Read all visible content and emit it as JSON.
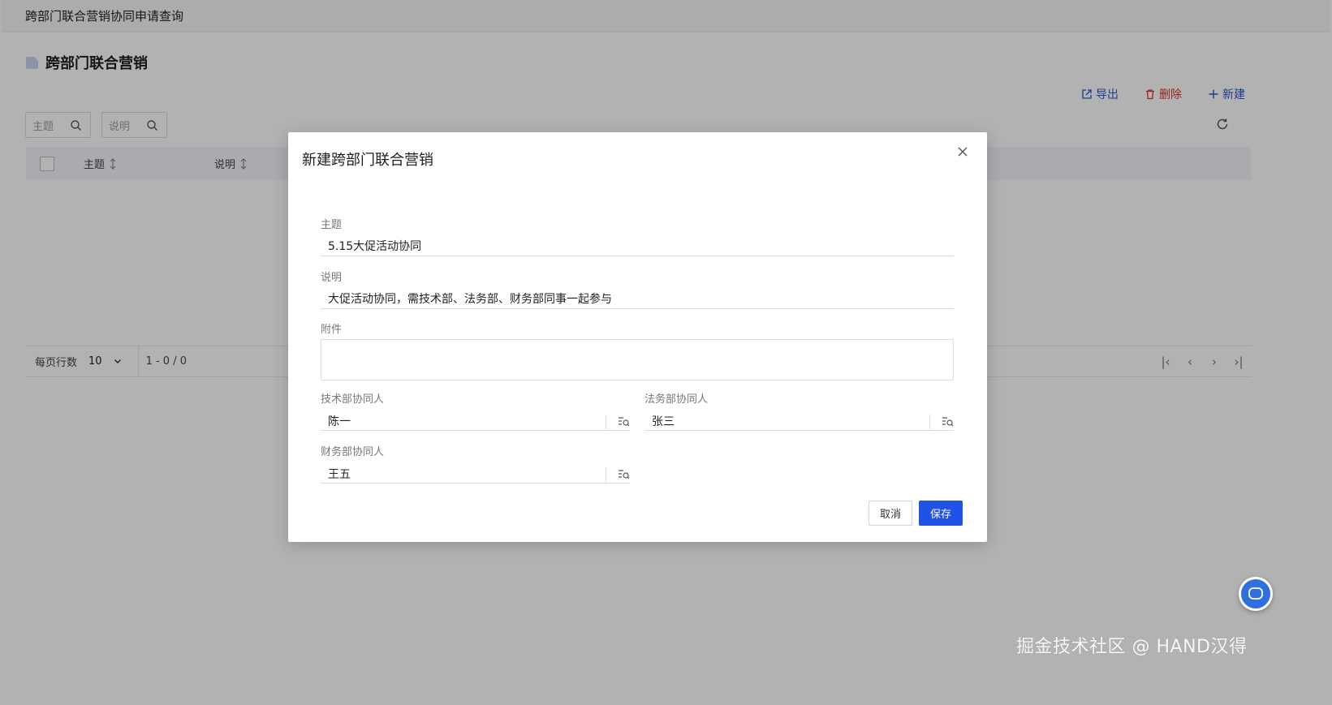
{
  "page": {
    "breadcrumb": "跨部门联合营销协同申请查询",
    "title": "跨部门联合营销",
    "actions": {
      "export": "导出",
      "delete": "删除",
      "create": "新建"
    },
    "search": [
      {
        "placeholder": "主题"
      },
      {
        "placeholder": "说明"
      }
    ],
    "table": {
      "columns": [
        "主题",
        "说明"
      ]
    },
    "pager": {
      "rows_label": "每页行数",
      "rows_value": "10",
      "range": "1 - 0 / 0"
    }
  },
  "modal": {
    "title": "新建跨部门联合营销",
    "fields": {
      "subject": {
        "label": "主题",
        "value": "5.15大促活动协同"
      },
      "description": {
        "label": "说明",
        "value": "大促活动协同，需技术部、法务部、财务部同事一起参与"
      },
      "attachment": {
        "label": "附件"
      },
      "tech": {
        "label": "技术部协同人",
        "value": "陈一"
      },
      "legal": {
        "label": "法务部协同人",
        "value": "张三"
      },
      "finance": {
        "label": "财务部协同人",
        "value": "王五"
      }
    },
    "buttons": {
      "cancel": "取消",
      "save": "保存"
    }
  },
  "watermark": "掘金技术社区 @ HAND汉得",
  "colors": {
    "primary": "#1f52e6",
    "danger": "#d6342b",
    "link": "#2756d6"
  }
}
